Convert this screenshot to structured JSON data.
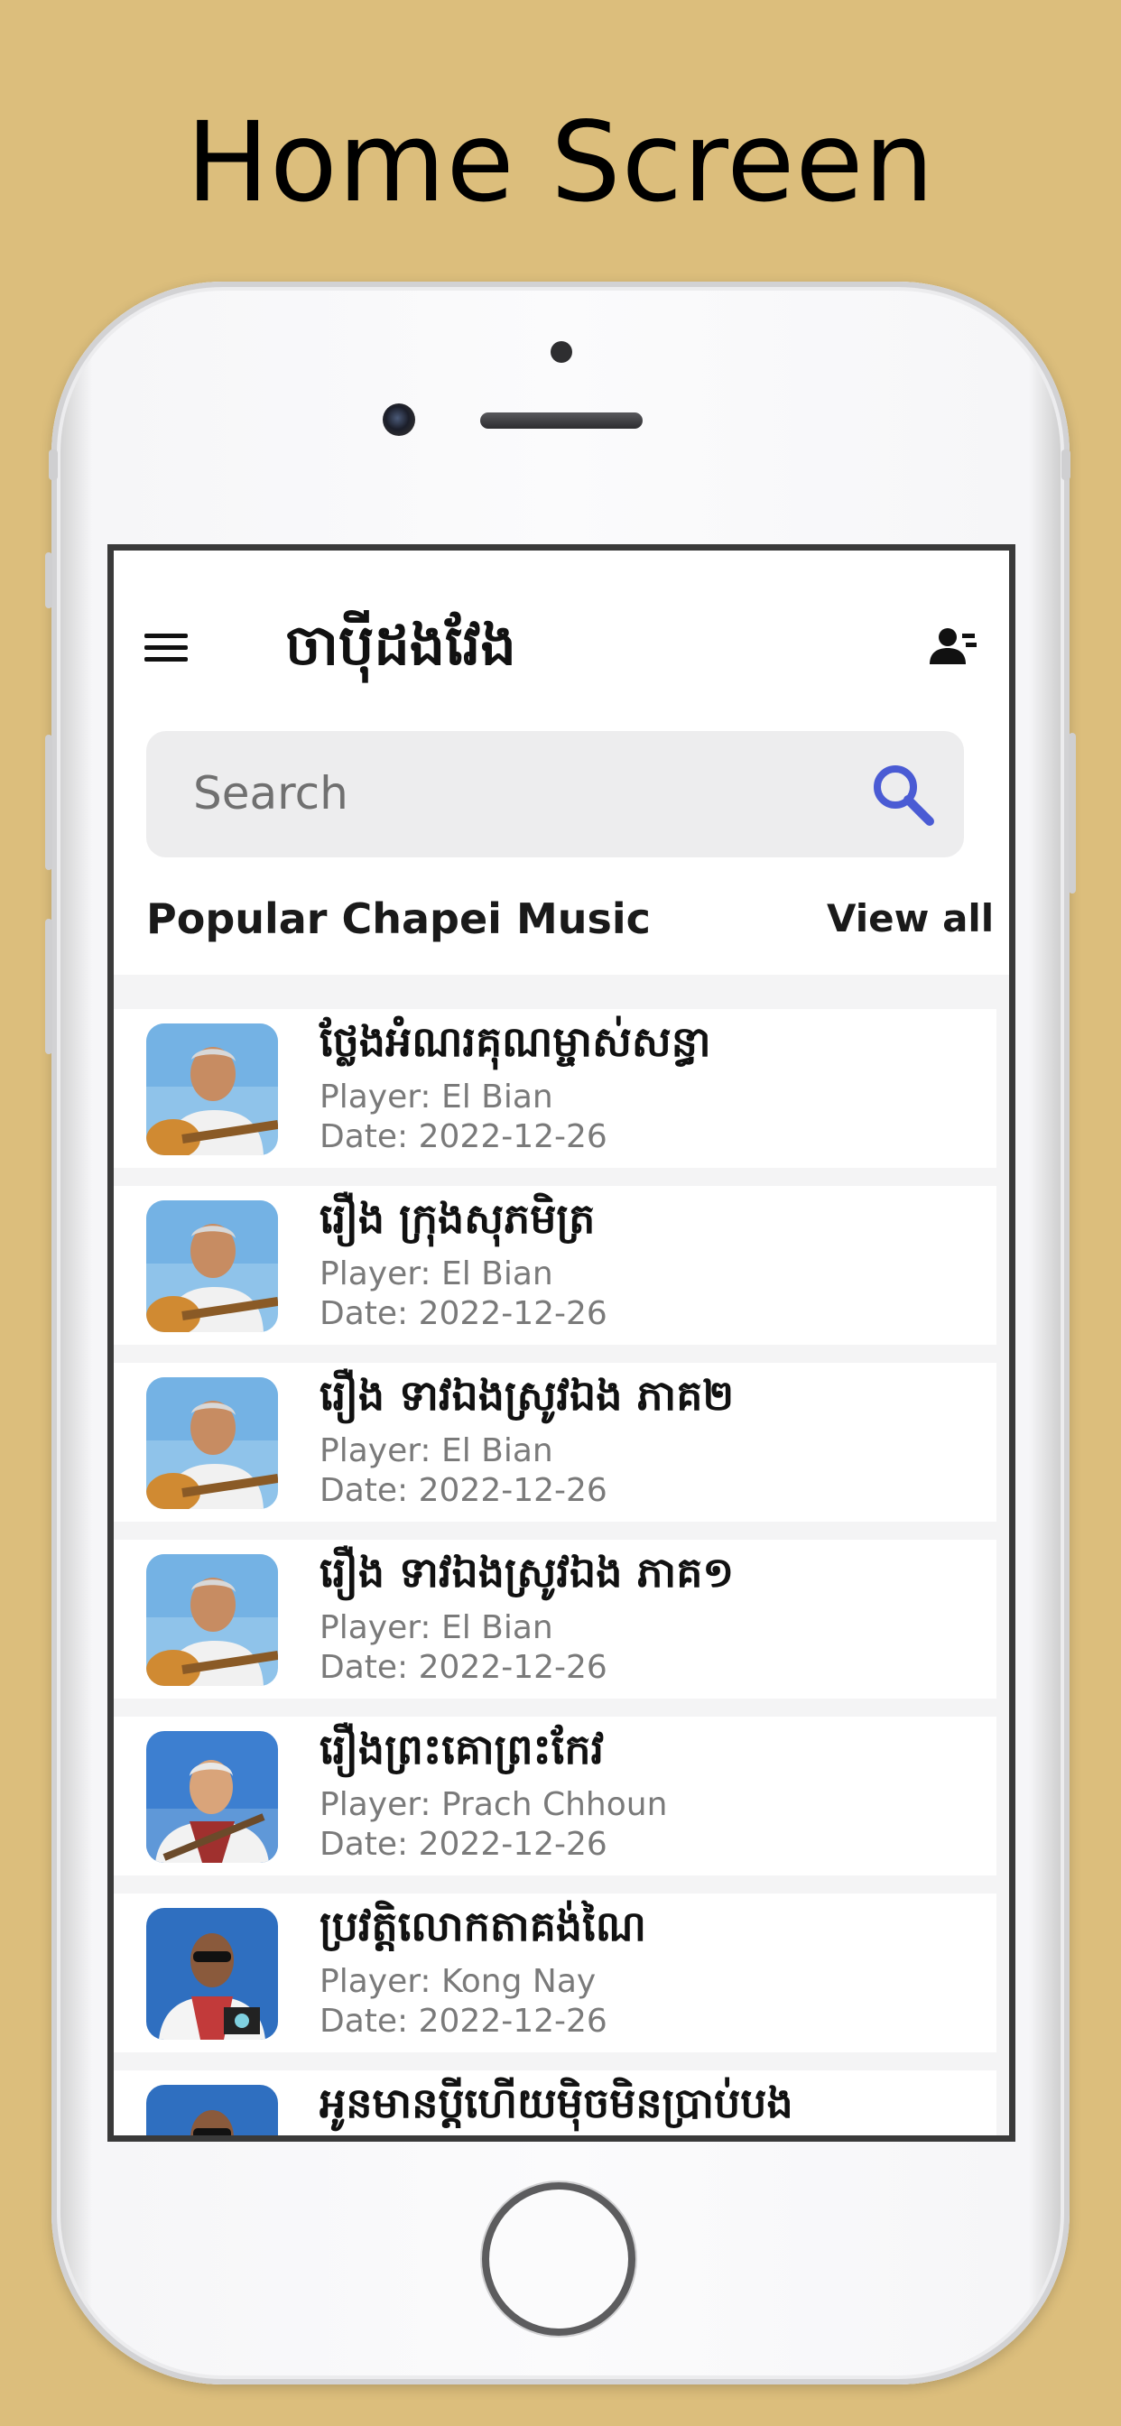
{
  "caption": "Home Screen",
  "header": {
    "title": "ចាប៉ីដងវែង",
    "menu_icon": "hamburger-menu-icon",
    "account_icon": "user-account-icon"
  },
  "search": {
    "placeholder": "Search",
    "icon": "search-icon"
  },
  "section": {
    "title": "Popular Chapei Music",
    "view_all": "View all"
  },
  "songs": [
    {
      "title": "ថ្លែងអំណរគុណម្ចាស់សន្ធា",
      "player": "Player: El Bian",
      "date": "Date: 2022-12-26",
      "artist_photo": "el-bian"
    },
    {
      "title": "រឿង ក្រុងសុភមិត្រ",
      "player": "Player: El Bian",
      "date": "Date: 2022-12-26",
      "artist_photo": "el-bian"
    },
    {
      "title": "រឿង ទាវឯងស្រូវឯង ភាគ២",
      "player": "Player: El Bian",
      "date": "Date: 2022-12-26",
      "artist_photo": "el-bian"
    },
    {
      "title": "រឿង ទាវឯងស្រូវឯង ភាគ១",
      "player": "Player: El Bian",
      "date": "Date: 2022-12-26",
      "artist_photo": "el-bian"
    },
    {
      "title": "រឿងព្រះគោព្រះកែវ",
      "player": "Player: Prach Chhoun",
      "date": "Date: 2022-12-26",
      "artist_photo": "prach-chhoun"
    },
    {
      "title": "ប្រវត្តិលោកតាគង់ណៃ",
      "player": "Player: Kong Nay",
      "date": "Date: 2022-12-26",
      "artist_photo": "kong-nay"
    },
    {
      "title": "អូនមានប្ដីហើយម៉ិចមិនប្រាប់បង",
      "player": "",
      "date": "",
      "artist_photo": "kong-nay"
    }
  ],
  "colors": {
    "background": "#dcbe7c",
    "search_accent": "#4a5bd4",
    "text_primary": "#111111",
    "text_secondary": "#7a7a7a"
  }
}
